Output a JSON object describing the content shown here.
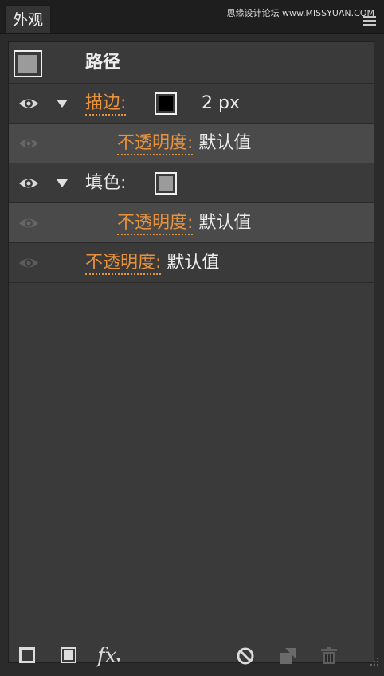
{
  "panel": {
    "tab_label": "外观",
    "watermark": "思缘设计论坛 www.MISSYUAN.COM"
  },
  "header": {
    "title": "路径",
    "swatch_color": "#9b9b9b"
  },
  "rows": {
    "stroke": {
      "label": "描边:",
      "weight": "2 px",
      "swatch_color": "#000000"
    },
    "stroke_opacity": {
      "label": "不透明度:",
      "value": "默认值"
    },
    "fill": {
      "label": "填色:",
      "swatch_color": "#9b9b9b"
    },
    "fill_opacity": {
      "label": "不透明度:",
      "value": "默认值"
    },
    "object_opacity": {
      "label": "不透明度:",
      "value": "默认值"
    }
  },
  "colors": {
    "link_orange": "#e8923c",
    "panel_bg": "#3a3a3a"
  },
  "icons": {
    "visibility": "eye-icon",
    "expand": "triangle-down-icon",
    "add_stroke": "add-stroke-icon",
    "add_fill": "add-fill-icon",
    "fx": "fx-icon",
    "clear": "clear-appearance-icon",
    "duplicate": "duplicate-item-icon",
    "delete": "trash-icon"
  }
}
